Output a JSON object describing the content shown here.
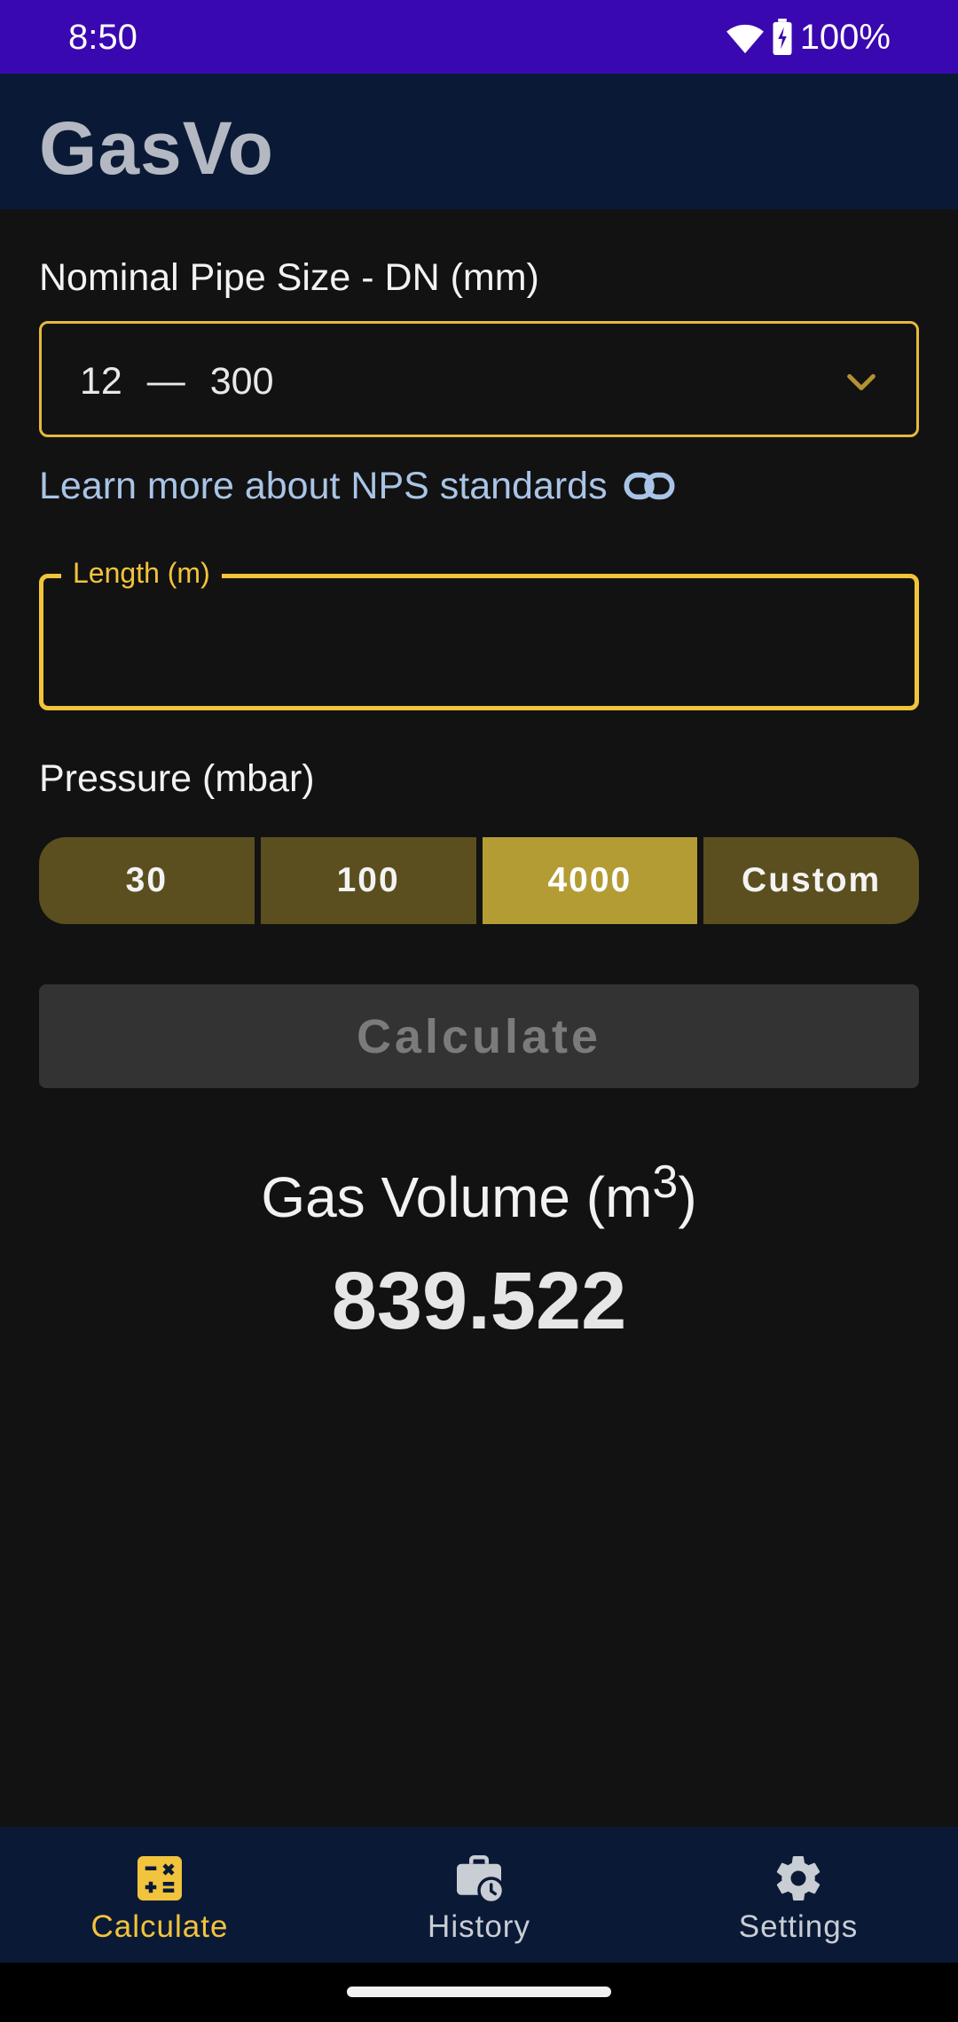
{
  "status_bar": {
    "time": "8:50",
    "battery": "100%"
  },
  "app_bar": {
    "title": "GasVo"
  },
  "pipe_size": {
    "label": "Nominal Pipe Size - DN (mm)",
    "value_from": "12",
    "separator": "—",
    "value_to": "300"
  },
  "nps_link": {
    "text": "Learn more about NPS standards",
    "icon": "link-icon"
  },
  "length_field": {
    "label": "Length (m)",
    "value": ""
  },
  "pressure": {
    "label": "Pressure (mbar)",
    "options": [
      "30",
      "100",
      "4000",
      "Custom"
    ],
    "selected": "4000"
  },
  "calculate_button": {
    "label": "Calculate",
    "enabled": false
  },
  "result": {
    "title": "Gas Volume (m",
    "superscript": "3",
    "title_suffix": ")",
    "value": "839.522"
  },
  "bottom_nav": {
    "items": [
      {
        "label": "Calculate",
        "icon": "calculator-icon",
        "active": true
      },
      {
        "label": "History",
        "icon": "history-briefcase-icon",
        "active": false
      },
      {
        "label": "Settings",
        "icon": "gear-icon",
        "active": false
      }
    ]
  },
  "colors": {
    "status_bar": "#3a08b0",
    "app_bar": "#0a1a36",
    "background": "#121212",
    "accent": "#f2c33c",
    "segment": "#5b4f1f",
    "segment_selected": "#b49c35",
    "link": "#a9c4e6"
  }
}
